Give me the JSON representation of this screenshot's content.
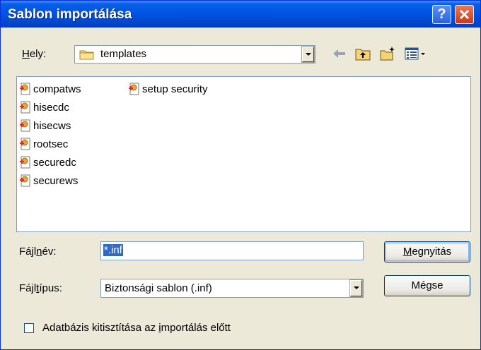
{
  "window": {
    "title": "Sablon importálása"
  },
  "titlebar_buttons": {
    "help": "?",
    "close": "X"
  },
  "location": {
    "label": "Hely:",
    "value": "templates"
  },
  "toolbar": {
    "icons": [
      "back-arrow-icon",
      "up-folder-icon",
      "new-folder-icon",
      "view-menu-icon"
    ]
  },
  "files": [
    {
      "name": "compatws"
    },
    {
      "name": "hisecdc"
    },
    {
      "name": "hisecws"
    },
    {
      "name": "rootsec"
    },
    {
      "name": "securedc"
    },
    {
      "name": "securews"
    },
    {
      "name": "setup security"
    }
  ],
  "filename": {
    "label": "Fájlnév:",
    "value": "*.inf"
  },
  "filetype": {
    "label": "Fájltípus:",
    "value": "Biztonsági sablon (.inf)"
  },
  "buttons": {
    "open": "Megnyitás",
    "cancel": "Mégse"
  },
  "checkbox": {
    "label": "Adatbázis kitisztítása az importálás előtt",
    "checked": false
  },
  "colors": {
    "titlebar": "#0054e3",
    "dialog_bg": "#ece9d8",
    "selection": "#316ac5"
  }
}
